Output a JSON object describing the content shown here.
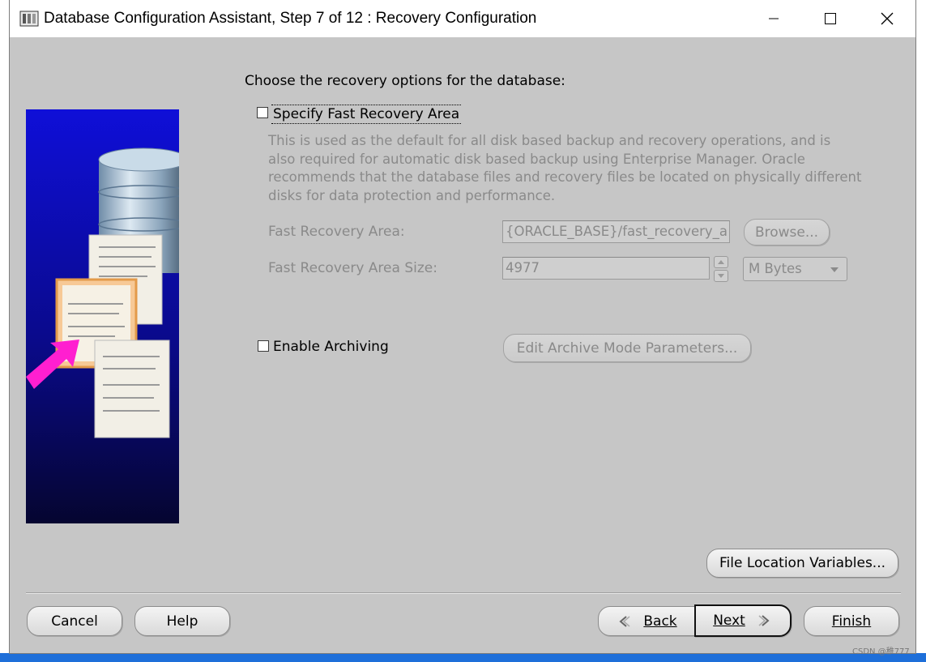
{
  "window": {
    "title": "Database Configuration Assistant, Step 7 of 12 : Recovery Configuration"
  },
  "main": {
    "prompt": "Choose the recovery options for the database:",
    "fast_recovery": {
      "checkbox_label": "Specify Fast Recovery Area",
      "checked": false,
      "description_lines": [
        "This is used as the default for all disk based backup and recovery operations, and is",
        "also required for automatic disk based backup using Enterprise Manager. Oracle",
        "recommends that the database files and recovery files be located on physically different",
        "disks for data protection and performance."
      ],
      "location_label": "Fast Recovery Area:",
      "location_value": "{ORACLE_BASE}/fast_recovery_a",
      "browse_label": "Browse...",
      "size_label": "Fast Recovery Area Size:",
      "size_value": "4977",
      "unit_value": "M Bytes"
    },
    "archiving": {
      "checkbox_label": "Enable Archiving",
      "checked": false,
      "edit_button_label": "Edit Archive Mode Parameters..."
    },
    "file_location_button_label": "File Location Variables..."
  },
  "footer": {
    "cancel_label": "Cancel",
    "help_label": "Help",
    "back_label": "Back",
    "next_label": "Next",
    "finish_label": "Finish"
  },
  "watermark": "CSDN @稚777",
  "colors": {
    "dialog_bg": "#c6c6c6",
    "disabled_text": "#8a8a8a",
    "illustration_blue": "#0a0a9a",
    "arrow_magenta": "#ff1fd0"
  }
}
